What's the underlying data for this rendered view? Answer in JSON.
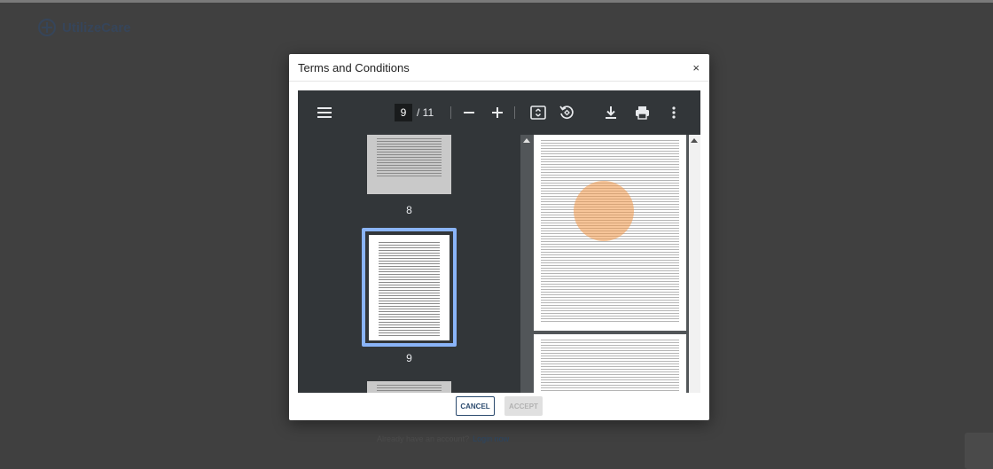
{
  "app": {
    "logo_text": "UtilizeCare"
  },
  "background": {
    "signin_prompt": "Already have an account?",
    "signin_link": "Login now"
  },
  "modal": {
    "title": "Terms and Conditions",
    "close_label": "×"
  },
  "pdf_viewer": {
    "current_page": "9",
    "total_pages": "/ 11",
    "toolbar_icons": [
      "menu-icon",
      "zoom-out-icon",
      "zoom-in-icon",
      "fit-page-icon",
      "rotate-icon",
      "download-icon",
      "print-icon",
      "more-vert-icon"
    ],
    "thumbnails": [
      {
        "label": "8"
      },
      {
        "label": "9",
        "selected": true
      }
    ]
  },
  "footer": {
    "cancel_label": "CANCEL",
    "accept_label": "ACCEPT"
  },
  "colors": {
    "toolbar_bg": "#323639",
    "viewer_bg": "#525659",
    "selection": "#8ab4f8",
    "primary": "#2b4a6e",
    "click_marker": "#f0964a"
  }
}
